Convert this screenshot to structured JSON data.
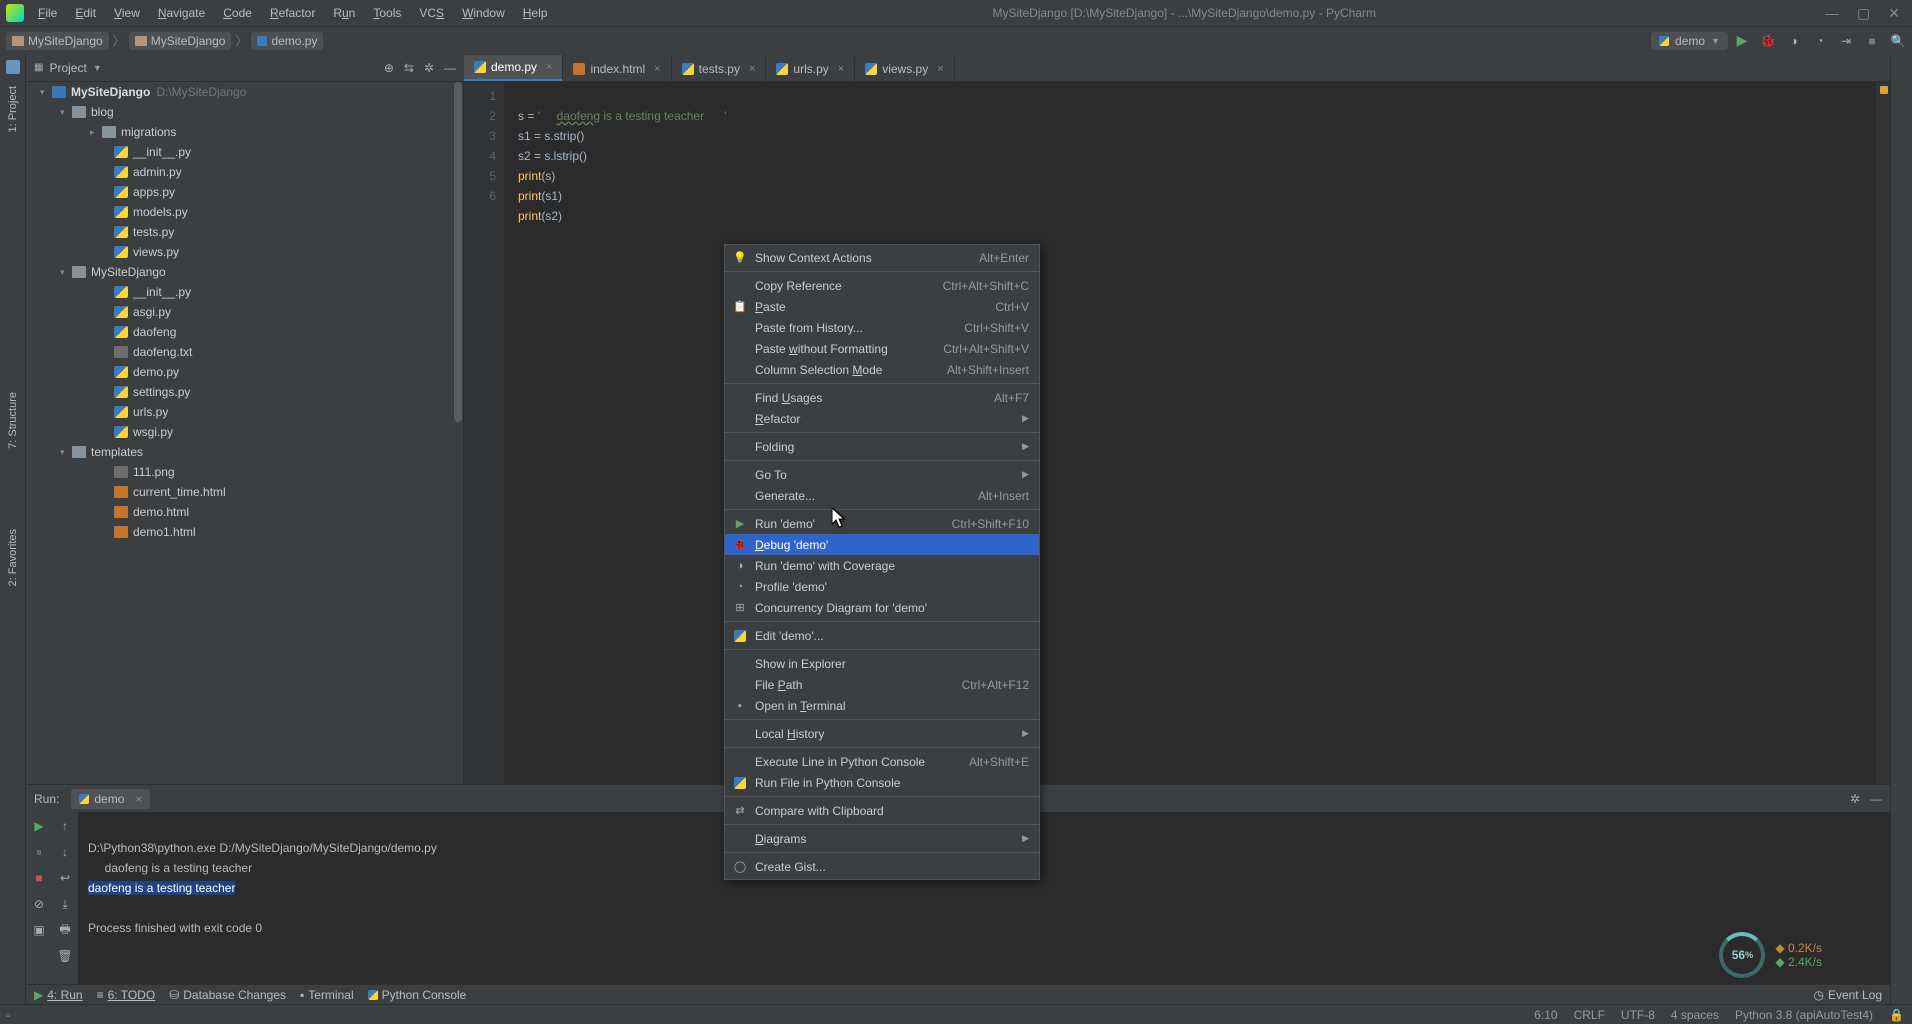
{
  "title_bar": {
    "project": "MySiteDjango",
    "path_hint": "[D:\\MySiteDjango] - ...\\MySiteDjango\\demo.py - PyCharm",
    "menus": [
      "File",
      "Edit",
      "View",
      "Navigate",
      "Code",
      "Refactor",
      "Run",
      "Tools",
      "VCS",
      "Window",
      "Help"
    ]
  },
  "breadcrumb": {
    "items": [
      "MySiteDjango",
      "MySiteDjango",
      "demo.py"
    ],
    "run_config": "demo"
  },
  "project_panel": {
    "title": "Project",
    "root": {
      "label": "MySiteDjango",
      "hint": "D:\\MySiteDjango"
    },
    "tree": [
      {
        "depth": 1,
        "type": "folder",
        "label": "blog",
        "arrow": "▾"
      },
      {
        "depth": 2,
        "type": "folder",
        "label": "migrations",
        "arrow": "▸"
      },
      {
        "depth": 3,
        "type": "py",
        "label": "__init__.py"
      },
      {
        "depth": 3,
        "type": "py",
        "label": "admin.py"
      },
      {
        "depth": 3,
        "type": "py",
        "label": "apps.py"
      },
      {
        "depth": 3,
        "type": "py",
        "label": "models.py"
      },
      {
        "depth": 3,
        "type": "py",
        "label": "tests.py"
      },
      {
        "depth": 3,
        "type": "py",
        "label": "views.py"
      },
      {
        "depth": 1,
        "type": "folder",
        "label": "MySiteDjango",
        "arrow": "▾"
      },
      {
        "depth": 3,
        "type": "py",
        "label": "__init__.py"
      },
      {
        "depth": 3,
        "type": "py",
        "label": "asgi.py"
      },
      {
        "depth": 3,
        "type": "py",
        "label": "daofeng"
      },
      {
        "depth": 3,
        "type": "txt",
        "label": "daofeng.txt"
      },
      {
        "depth": 3,
        "type": "py",
        "label": "demo.py"
      },
      {
        "depth": 3,
        "type": "py",
        "label": "settings.py"
      },
      {
        "depth": 3,
        "type": "py",
        "label": "urls.py"
      },
      {
        "depth": 3,
        "type": "py",
        "label": "wsgi.py"
      },
      {
        "depth": 1,
        "type": "folder",
        "label": "templates",
        "arrow": "▾"
      },
      {
        "depth": 3,
        "type": "png",
        "label": "111.png"
      },
      {
        "depth": 3,
        "type": "html",
        "label": "current_time.html"
      },
      {
        "depth": 3,
        "type": "html",
        "label": "demo.html"
      },
      {
        "depth": 3,
        "type": "html",
        "label": "demo1.html"
      }
    ]
  },
  "left_tools": [
    "1: Project",
    "7: Structure",
    "2: Favorites"
  ],
  "editor": {
    "tabs": [
      {
        "label": "demo.py",
        "type": "py",
        "active": true
      },
      {
        "label": "index.html",
        "type": "html"
      },
      {
        "label": "tests.py",
        "type": "py"
      },
      {
        "label": "urls.py",
        "type": "py"
      },
      {
        "label": "views.py",
        "type": "py"
      }
    ],
    "lines": [
      "1",
      "2",
      "3",
      "4",
      "5",
      "6"
    ],
    "code": {
      "l1a": "s = ",
      "l1b": "'     ",
      "l1c": "daofeng",
      "l1d": " is a testing teacher      '",
      "l2a": "s1 = s.strip()",
      "l3a": "s2 = s.lstrip()",
      "l4p": "print",
      "l4a": "(s)",
      "l5p": "print",
      "l5a": "(s1)",
      "l6p": "print",
      "l6a": "(s2)"
    }
  },
  "run_panel": {
    "label": "Run:",
    "tab": "demo",
    "output": {
      "l1": "D:\\Python38\\python.exe D:/MySiteDjango/MySiteDjango/demo.py",
      "l2": "     daofeng is a testing teacher      ",
      "l3": "daofeng is a testing teacher",
      "l4": "",
      "l5": "Process finished with exit code 0"
    }
  },
  "bottom_tabs": [
    {
      "label": "4: Run",
      "icon": "▶"
    },
    {
      "label": "6: TODO",
      "icon": "≡"
    },
    {
      "label": "Database Changes",
      "icon": "⛁"
    },
    {
      "label": "Terminal",
      "icon": "▪"
    },
    {
      "label": "Python Console",
      "icon": "py"
    }
  ],
  "event_log": "Event Log",
  "status": {
    "pos": "6:10",
    "eol": "CRLF",
    "enc": "UTF-8",
    "indent": "4 spaces",
    "interp": "Python 3.8 (apiAutoTest4)",
    "lock": "🔒"
  },
  "context_menu": [
    {
      "type": "item",
      "label": "Show Context Actions",
      "shortcut": "Alt+Enter",
      "icon": "bulb"
    },
    {
      "type": "sep"
    },
    {
      "type": "item",
      "label": "Copy Reference",
      "shortcut": "Ctrl+Alt+Shift+C"
    },
    {
      "type": "item",
      "label": "Paste",
      "shortcut": "Ctrl+V",
      "icon": "paste",
      "u": 0
    },
    {
      "type": "item",
      "label": "Paste from History...",
      "shortcut": "Ctrl+Shift+V"
    },
    {
      "type": "item",
      "label": "Paste without Formatting",
      "shortcut": "Ctrl+Alt+Shift+V",
      "u": 6
    },
    {
      "type": "item",
      "label": "Column Selection Mode",
      "shortcut": "Alt+Shift+Insert",
      "u": 17
    },
    {
      "type": "sep"
    },
    {
      "type": "item",
      "label": "Find Usages",
      "shortcut": "Alt+F7",
      "u": 5
    },
    {
      "type": "item",
      "label": "Refactor",
      "sub": true,
      "u": 0
    },
    {
      "type": "sep"
    },
    {
      "type": "item",
      "label": "Folding",
      "sub": true
    },
    {
      "type": "sep"
    },
    {
      "type": "item",
      "label": "Go To",
      "sub": true
    },
    {
      "type": "item",
      "label": "Generate...",
      "shortcut": "Alt+Insert"
    },
    {
      "type": "sep"
    },
    {
      "type": "item",
      "label": "Run 'demo'",
      "shortcut": "Ctrl+Shift+F10",
      "icon": "play"
    },
    {
      "type": "item",
      "label": "Debug 'demo'",
      "icon": "bug",
      "selected": true,
      "u": 0
    },
    {
      "type": "item",
      "label": "Run 'demo' with Coverage",
      "icon": "shield"
    },
    {
      "type": "item",
      "label": "Profile 'demo'",
      "icon": "profile"
    },
    {
      "type": "item",
      "label": "Concurrency Diagram for 'demo'",
      "icon": "conc"
    },
    {
      "type": "sep"
    },
    {
      "type": "item",
      "label": "Edit 'demo'...",
      "icon": "py"
    },
    {
      "type": "sep"
    },
    {
      "type": "item",
      "label": "Show in Explorer"
    },
    {
      "type": "item",
      "label": "File Path",
      "shortcut": "Ctrl+Alt+F12",
      "u": 5
    },
    {
      "type": "item",
      "label": "Open in Terminal",
      "icon": "term",
      "u": 8
    },
    {
      "type": "sep"
    },
    {
      "type": "item",
      "label": "Local History",
      "sub": true,
      "u": 6
    },
    {
      "type": "sep"
    },
    {
      "type": "item",
      "label": "Execute Line in Python Console",
      "shortcut": "Alt+Shift+E"
    },
    {
      "type": "item",
      "label": "Run File in Python Console",
      "icon": "py"
    },
    {
      "type": "sep"
    },
    {
      "type": "item",
      "label": "Compare with Clipboard",
      "icon": "cmp"
    },
    {
      "type": "sep"
    },
    {
      "type": "item",
      "label": "Diagrams",
      "sub": true,
      "u": 0
    },
    {
      "type": "sep"
    },
    {
      "type": "item",
      "label": "Create Gist...",
      "icon": "gh"
    }
  ],
  "overlay": {
    "cpu": "56",
    "cpu_unit": "%",
    "up": "0.2K/s",
    "down": "2.4K/s"
  }
}
